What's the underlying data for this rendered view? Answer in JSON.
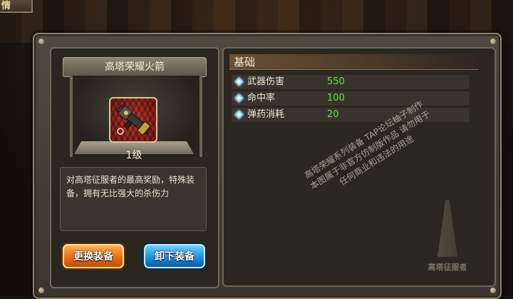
{
  "window_title": "情",
  "item": {
    "name": "高塔荣耀火箭",
    "level": "1级",
    "description": "对高塔征服者的最高奖励，特殊装备，拥有无比强大的杀伤力",
    "icon": "rocket-launcher-icon"
  },
  "buttons": {
    "replace": "更换装备",
    "unequip": "卸下装备"
  },
  "stats_section": {
    "title": "基础",
    "rows": [
      {
        "label": "武器伤害",
        "value": "550"
      },
      {
        "label": "命中率",
        "value": "100"
      },
      {
        "label": "弹药消耗",
        "value": "20"
      }
    ]
  },
  "watermark": {
    "line1": "高塔荣耀系列装备   TAP论坛柚子制作",
    "line2": "本图属于非官方仿制版作品   请勿用于",
    "line3": "任何商业和违法的用途",
    "logo_text": "高塔征服者"
  },
  "colors": {
    "stat_value": "#62e042",
    "replace_button": "#e86a10",
    "unequip_button": "#1a8ae0"
  }
}
